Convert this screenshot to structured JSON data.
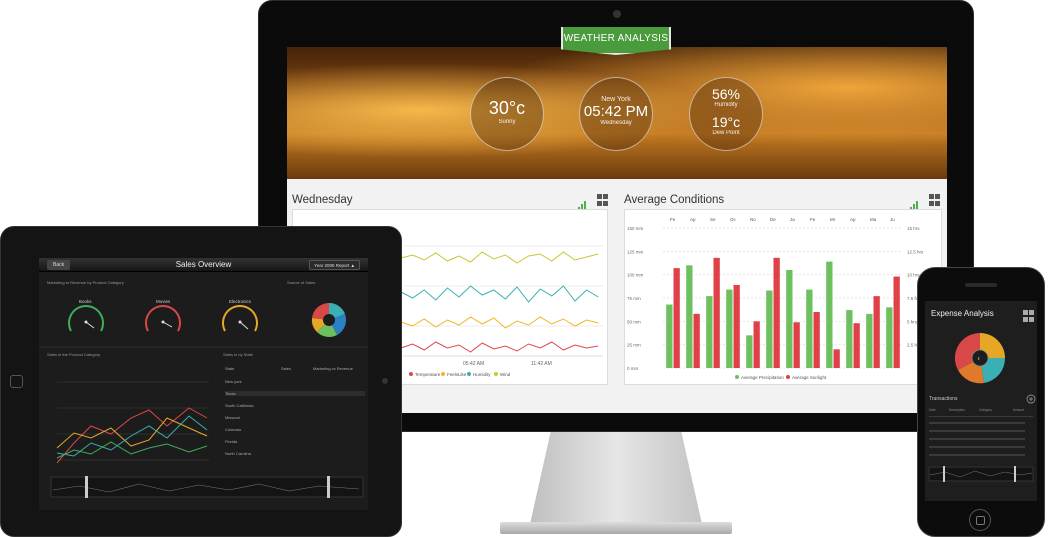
{
  "desktop": {
    "banner": "WEATHER ANALYSIS",
    "weather": {
      "temperature": {
        "value": "30°c",
        "label": "Sunny"
      },
      "time": {
        "city": "New York",
        "time": "05:42 PM",
        "day": "Wednesday"
      },
      "humidity": {
        "value": "56%",
        "label": "Humidity"
      },
      "dew": {
        "value": "19°c",
        "label": "Dew Point"
      }
    },
    "left_panel": {
      "title": "Wednesday",
      "time_ticks": [
        "05:42 AM",
        "11:42 AM"
      ],
      "legend": [
        "Temperature",
        "FeelsLike",
        "Humidity",
        "Wind"
      ],
      "colors": [
        "#e04848",
        "#f2b624",
        "#3ab0b4",
        "#c8c832"
      ]
    },
    "right_panel": {
      "title": "Average Conditions",
      "months": [
        "Fe",
        "Ap",
        "Se",
        "Oc",
        "No",
        "De",
        "Ja",
        "Fe",
        "Mr",
        "Ap",
        "Ma",
        "Ju"
      ],
      "left_axis": [
        "150 mm",
        "125 mm",
        "100 mm",
        "75 mm",
        "50 mm",
        "25 mm",
        "0 mm"
      ],
      "right_axis": [
        "15 hrs",
        "12.5 hrs",
        "10 hrs",
        "7.5 hrs",
        "5 hrs",
        "2.5 hrs"
      ],
      "legend": [
        "Average Precipitation",
        "Average Sunlight"
      ],
      "colors": {
        "precip": "#6cc05e",
        "sun": "#e04048"
      }
    }
  },
  "chart_data": {
    "type": "bar",
    "title": "Average Conditions",
    "categories": [
      "Fe",
      "Ap",
      "Se",
      "Oc",
      "No",
      "De",
      "Ja",
      "Fe",
      "Mr",
      "Ap",
      "Ma",
      "Ju"
    ],
    "ylim": [
      0,
      150
    ],
    "series": [
      {
        "name": "Average Precipitation",
        "values": [
          68,
          110,
          77,
          84,
          35,
          83,
          105,
          84,
          114,
          62,
          58,
          65
        ]
      },
      {
        "name": "Average Sunlight",
        "values": [
          107,
          58,
          118,
          89,
          50,
          118,
          49,
          60,
          20,
          48,
          77,
          98
        ]
      }
    ]
  },
  "tablet": {
    "back": "Back",
    "title": "Sales Overview",
    "report": "Year 2005 Report ▲",
    "gauges_caption": "Marketing to Revenue by Product Category",
    "gauges": [
      "Books",
      "Movies",
      "Electronics"
    ],
    "source_caption": "Source of Sales",
    "product_caption": "Sales in the Product Category",
    "state_caption": "Sales in by State",
    "table_headers": [
      "State",
      "Sales",
      "Marketing vs Revenue"
    ],
    "states": [
      "New york",
      "Texas",
      "South California",
      "Missouri",
      "Colorado",
      "Florida",
      "North Carolina"
    ]
  },
  "phone": {
    "title": "Expense Analysis",
    "transactions": "Transactions",
    "headers": [
      "Date",
      "Description",
      "Category",
      "Amount"
    ]
  }
}
